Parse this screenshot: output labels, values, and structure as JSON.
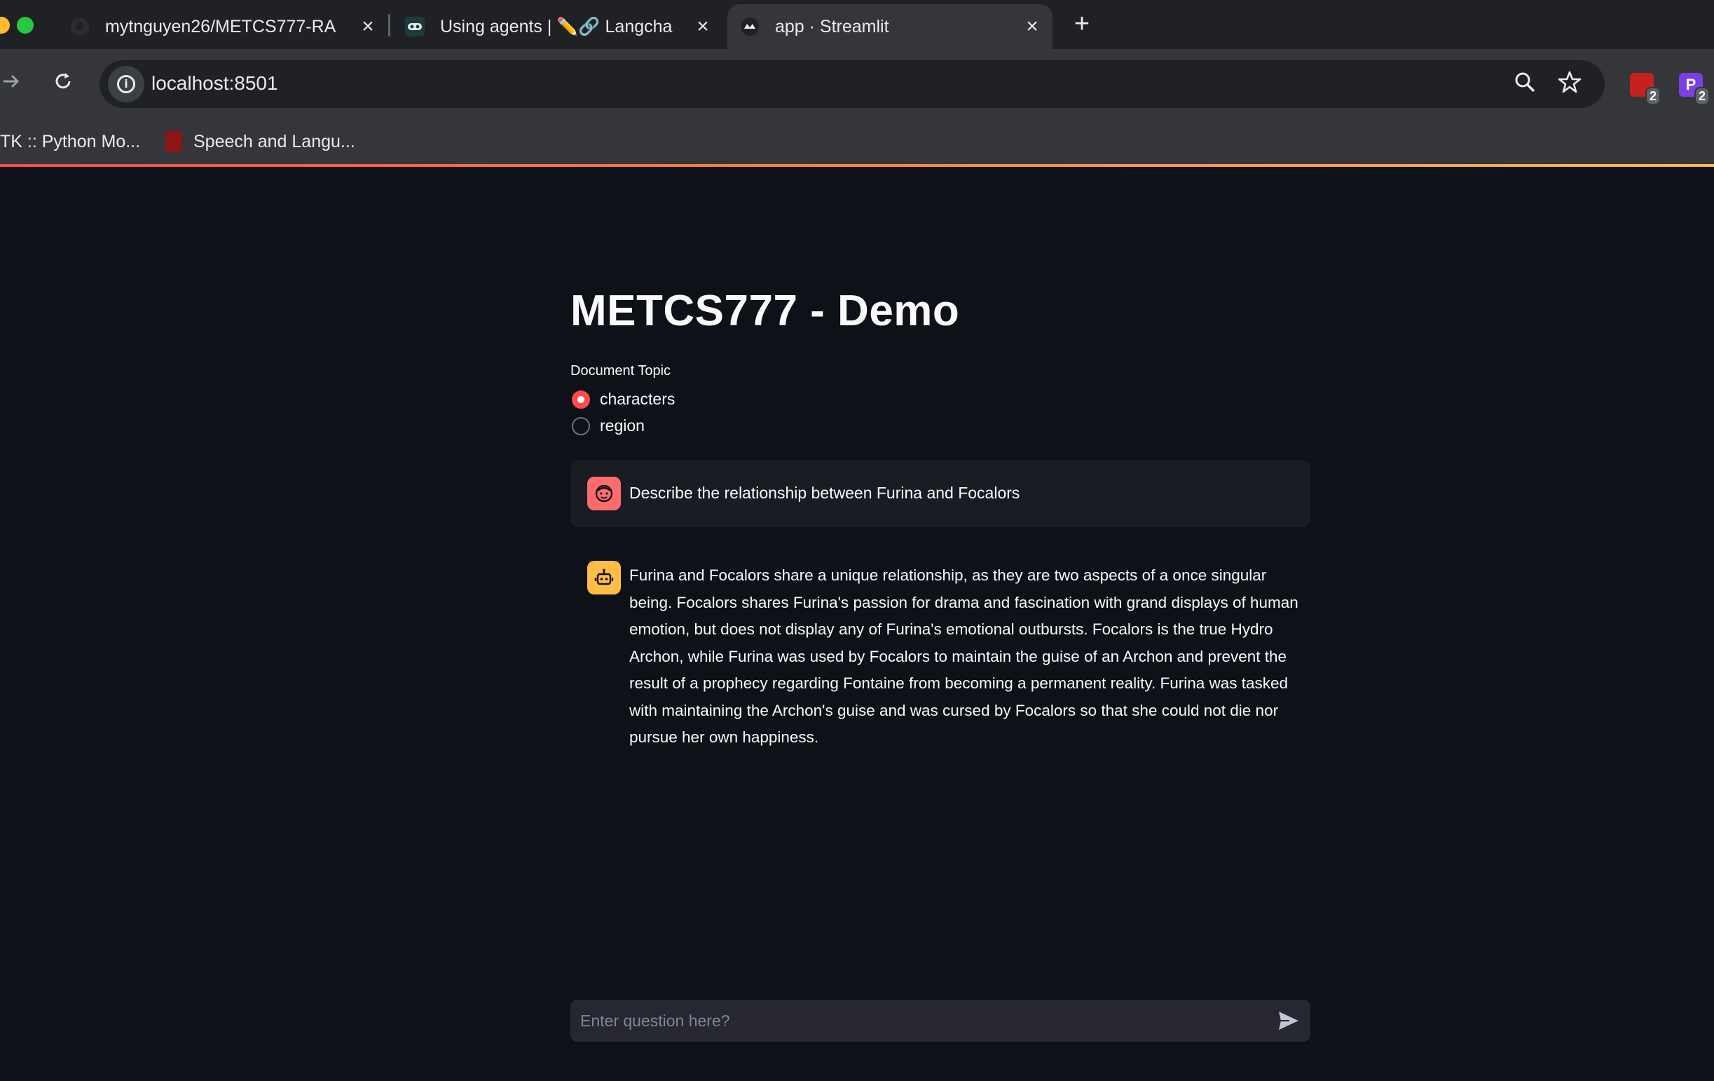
{
  "browser": {
    "tabs": [
      {
        "title": "mytnguyen26/METCS777-RA",
        "icon": "github-icon"
      },
      {
        "title": "Using agents | ✏️🔗 Langcha",
        "icon": "langchain-icon"
      },
      {
        "title": "app · Streamlit",
        "icon": "streamlit-icon",
        "active": true
      }
    ],
    "new_tab_label": "+",
    "url": "localhost:8501",
    "bookmarks": [
      {
        "label": "TK :: Python Mo..."
      },
      {
        "label": "Speech and Langu...",
        "icon": "stanford-icon"
      }
    ],
    "extensions": [
      {
        "icon": "extension-red-icon",
        "badge": "2",
        "color": "#c5221f"
      },
      {
        "icon": "extension-purple-icon",
        "letter": "P",
        "badge": "2",
        "color": "#7b3fe4"
      }
    ]
  },
  "app": {
    "title": "METCS777 - Demo",
    "radio": {
      "label": "Document Topic",
      "options": [
        "characters",
        "region"
      ],
      "selected": "characters"
    },
    "messages": [
      {
        "role": "user",
        "avatar": "user-face-icon",
        "text": "Describe the relationship between Furina and Focalors"
      },
      {
        "role": "assistant",
        "avatar": "robot-icon",
        "text": "Furina and Focalors share a unique relationship, as they are two aspects of a once singular being. Focalors shares Furina's passion for drama and fascination with grand displays of human emotion, but does not display any of Furina's emotional outbursts. Focalors is the true Hydro Archon, while Furina was used by Focalors to maintain the guise of an Archon and prevent the result of a prophecy regarding Fontaine from becoming a permanent reality. Furina was tasked with maintaining the Archon's guise and was cursed by Focalors so that she could not die nor pursue her own happiness."
      }
    ],
    "chat_input": {
      "placeholder": "Enter question here?"
    },
    "colors": {
      "primary": "#ff4b4b",
      "background": "#0e1117",
      "secondary_bg": "#262730"
    }
  }
}
